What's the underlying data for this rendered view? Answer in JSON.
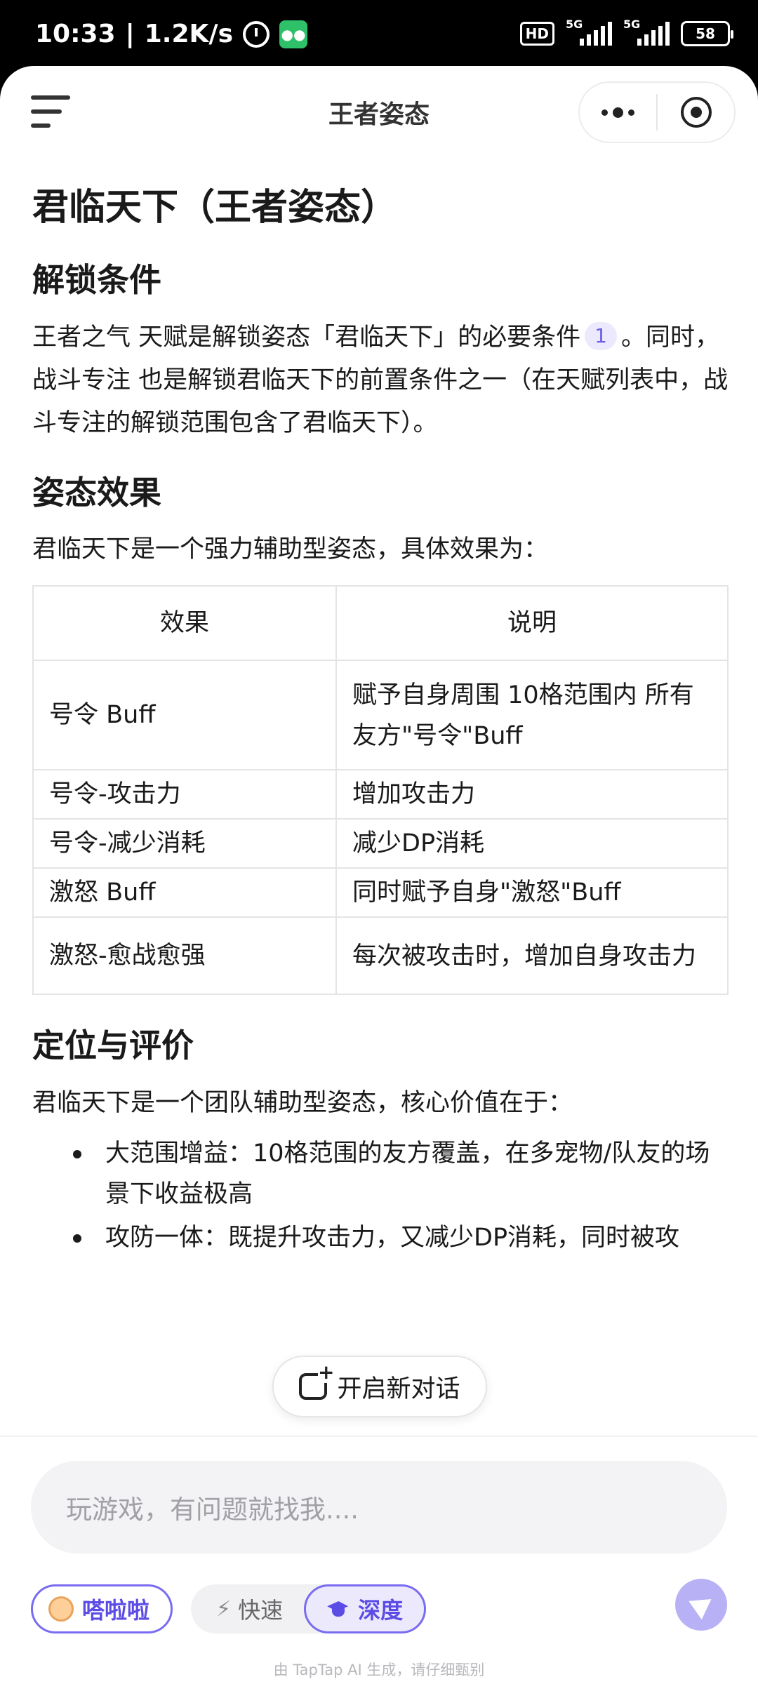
{
  "status_bar": {
    "time": "10:33",
    "network_speed": "1.2K/s",
    "hd_badge": "HD",
    "signal_1_label": "5G",
    "signal_2_label": "5G",
    "battery": "58"
  },
  "navbar": {
    "title": "王者姿态"
  },
  "article": {
    "title": "君临天下（王者姿态）",
    "sections": [
      {
        "heading": "解锁条件",
        "para_part1": "王者之气 天赋是解锁姿态「君临天下」的必要条件",
        "citation": "1",
        "para_part2": "。同时，战斗专注 也是解锁君临天下的前置条件之一（在天赋列表中，战斗专注的解锁范围包含了君临天下）。"
      },
      {
        "heading": "姿态效果",
        "intro": "君临天下是一个强力辅助型姿态，具体效果为：",
        "table": {
          "headers": [
            "效果",
            "说明"
          ],
          "rows": [
            [
              "号令 Buff",
              "赋予自身周围 10格范围内 所有友方\"号令\"Buff"
            ],
            [
              "号令-攻击力",
              "增加攻击力"
            ],
            [
              "号令-减少消耗",
              "减少DP消耗"
            ],
            [
              "激怒 Buff",
              "同时赋予自身\"激怒\"Buff"
            ],
            [
              "激怒-愈战愈强",
              "每次被攻击时，增加自身攻击力"
            ]
          ]
        }
      },
      {
        "heading": "定位与评价",
        "intro": "君临天下是一个团队辅助型姿态，核心价值在于：",
        "bullets": [
          "大范围增益：10格范围的友方覆盖，在多宠物/队友的场景下收益极高",
          "攻防一体：既提升攻击力，又减少DP消耗，同时被攻"
        ]
      }
    ]
  },
  "new_chat_label": "开启新对话",
  "composer": {
    "placeholder": "玩游戏，有问题就找我....",
    "agent_label": "嗒啦啦",
    "mode_fast": "快速",
    "mode_deep": "深度",
    "disclaimer": "由 TapTap AI 生成，请仔细甄别"
  },
  "colors": {
    "accent": "#6b5ce7",
    "accent_light": "#ece9fd",
    "send_button": "#b9b1f5"
  }
}
